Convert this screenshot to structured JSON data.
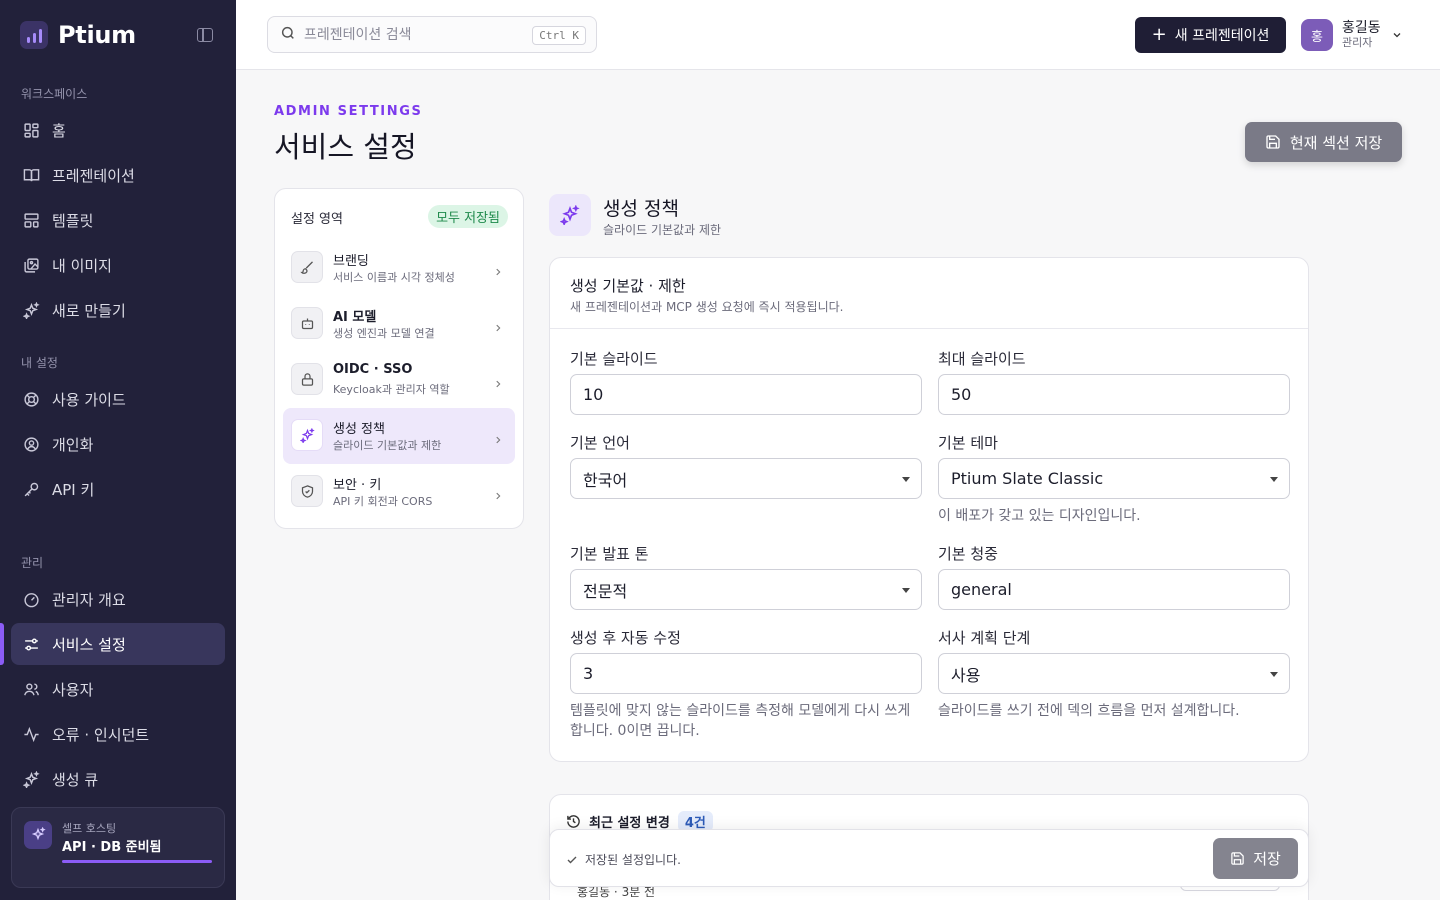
{
  "brand": {
    "name": "Ptium"
  },
  "sidebar": {
    "workspace_label": "워크스페이스",
    "workspace_items": [
      {
        "label": "홈",
        "icon": "grid-icon"
      },
      {
        "label": "프레젠테이션",
        "icon": "book-icon"
      },
      {
        "label": "템플릿",
        "icon": "template-icon"
      },
      {
        "label": "내 이미지",
        "icon": "image-icon"
      },
      {
        "label": "새로 만들기",
        "icon": "sparkle-icon"
      }
    ],
    "my_settings_label": "내 설정",
    "my_settings_items": [
      {
        "label": "사용 가이드",
        "icon": "lifebuoy-icon"
      },
      {
        "label": "개인화",
        "icon": "user-circle-icon"
      },
      {
        "label": "API 키",
        "icon": "key-icon"
      }
    ],
    "admin_label": "관리",
    "admin_items": [
      {
        "label": "관리자 개요",
        "icon": "gauge-icon"
      },
      {
        "label": "서비스 설정",
        "icon": "sliders-icon",
        "active": true
      },
      {
        "label": "사용자",
        "icon": "users-icon"
      },
      {
        "label": "오류 · 인시던트",
        "icon": "activity-icon"
      },
      {
        "label": "생성 큐",
        "icon": "sparkle-icon"
      }
    ],
    "status": {
      "small": "셀프 호스팅",
      "main": "API · DB 준비됨"
    }
  },
  "topbar": {
    "search_placeholder": "프레젠테이션 검색",
    "search_shortcut": "Ctrl K",
    "new_button": "새 프레젠테이션",
    "user": {
      "initial": "홍",
      "name": "홍길동",
      "role": "관리자"
    }
  },
  "header": {
    "eyebrow": "ADMIN SETTINGS",
    "title": "서비스 설정",
    "save_section_button": "현재 섹션 저장"
  },
  "areas": {
    "title": "설정 영역",
    "badge": "모두 저장됨",
    "items": [
      {
        "title": "브랜딩",
        "sub": "서비스 이름과 시각 정체성",
        "icon": "brush-icon"
      },
      {
        "title": "AI 모델",
        "sub": "생성 엔진과 모델 연결",
        "icon": "robot-icon"
      },
      {
        "title": "OIDC · SSO",
        "sub": "Keycloak과 관리자 역할",
        "icon": "lock-icon"
      },
      {
        "title": "생성 정책",
        "sub": "슬라이드 기본값과 제한",
        "icon": "sparkle-icon",
        "active": true
      },
      {
        "title": "보안 · 키",
        "sub": "API 키 회전과 CORS",
        "icon": "shield-check-icon"
      }
    ]
  },
  "section": {
    "title": "생성 정책",
    "subtitle": "슬라이드 기본값과 제한"
  },
  "form": {
    "card_title": "생성 기본값 · 제한",
    "card_desc": "새 프레젠테이션과 MCP 생성 요청에 즉시 적용됩니다.",
    "default_slides": {
      "label": "기본 슬라이드",
      "value": "10"
    },
    "max_slides": {
      "label": "최대 슬라이드",
      "value": "50"
    },
    "default_language": {
      "label": "기본 언어",
      "value": "한국어"
    },
    "default_theme": {
      "label": "기본 테마",
      "value": "Ptium Slate Classic",
      "hint": "이 배포가 갖고 있는 디자인입니다."
    },
    "default_tone": {
      "label": "기본 발표 톤",
      "value": "전문적"
    },
    "default_audience": {
      "label": "기본 청중",
      "value": "general"
    },
    "auto_fix": {
      "label": "생성 후 자동 수정",
      "value": "3",
      "hint": "템플릿에 맞지 않는 슬라이드를 측정해 모델에게 다시 쓰게 합니다. 0이면 끕니다."
    },
    "narrative": {
      "label": "서사 계획 단계",
      "value": "사용",
      "hint": "슬라이드를 쓰기 전에 덱의 흐름을 먼저 설계합니다."
    }
  },
  "recent": {
    "title": "최근 설정 변경",
    "count": "4건",
    "row_text": "홍길동 · 3분 전"
  },
  "toast": {
    "message": "저장된 설정입니다.",
    "button": "저장"
  }
}
